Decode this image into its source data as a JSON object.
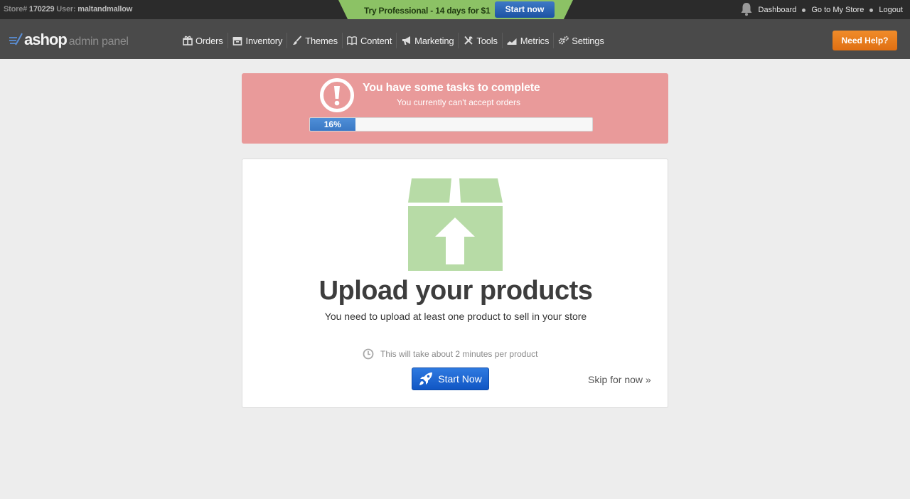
{
  "topbar": {
    "store_label": "Store#",
    "store_number": "170229",
    "user_label": "User:",
    "username": "maltandmallow",
    "promo_text": "Try Professional - 14 days for $1",
    "promo_button": "Start now",
    "links": [
      "Dashboard",
      "Go to My Store",
      "Logout"
    ],
    "promo_color": "#8cc265"
  },
  "nav": {
    "logo_name": "ashop",
    "logo_sub": "admin panel",
    "items": [
      {
        "label": "Orders",
        "icon": "gift-icon"
      },
      {
        "label": "Inventory",
        "icon": "box-icon"
      },
      {
        "label": "Themes",
        "icon": "brush-icon"
      },
      {
        "label": "Content",
        "icon": "book-icon"
      },
      {
        "label": "Marketing",
        "icon": "megaphone-icon"
      },
      {
        "label": "Tools",
        "icon": "tools-icon"
      },
      {
        "label": "Metrics",
        "icon": "chart-icon"
      },
      {
        "label": "Settings",
        "icon": "gears-icon"
      }
    ],
    "help_button": "Need Help?"
  },
  "alert": {
    "title": "You have some tasks to complete",
    "subtitle": "You currently can't accept orders",
    "progress_label": "16%",
    "progress_value": 0.16,
    "color": "#e99a9a"
  },
  "card": {
    "title": "Upload your products",
    "description": "You need to upload at least one product to sell in your store",
    "time_note": "This will take about 2 minutes per product",
    "start_button": "Start Now",
    "skip_link": "Skip for now »",
    "illustration": "upload-box-icon",
    "illustration_color": "#b7dba6"
  }
}
